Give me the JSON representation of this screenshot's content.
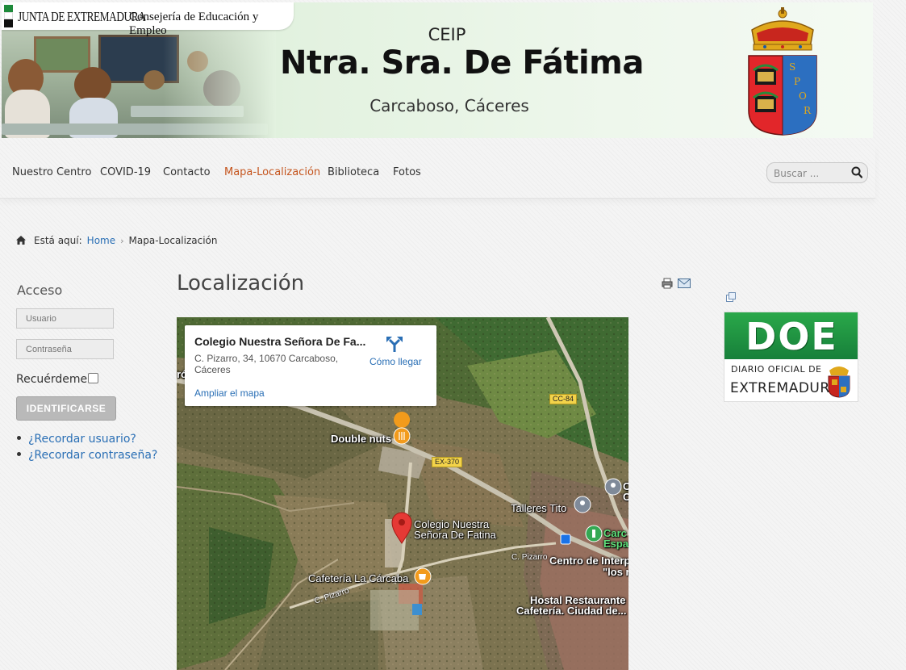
{
  "header": {
    "junta_name": "JUNTA DE EXTREMADURA",
    "junta_department": "Consejería de Educación y Empleo",
    "school_prefix": "CEIP",
    "school_name": "Ntra. Sra. De Fátima",
    "school_location": "Carcaboso, Cáceres",
    "crest_letters": [
      "S",
      "P",
      "O",
      "R"
    ]
  },
  "nav": {
    "items": [
      {
        "label": "Nuestro Centro"
      },
      {
        "label": "COVID-19"
      },
      {
        "label": "Contacto"
      },
      {
        "label": "Mapa-Localización",
        "active": true
      },
      {
        "label": "Biblioteca"
      },
      {
        "label": "Fotos"
      }
    ],
    "search_placeholder": "Buscar ..."
  },
  "breadcrumb": {
    "prefix": "Está aquí:",
    "home": "Home",
    "current": "Mapa-Localización"
  },
  "login": {
    "title": "Acceso",
    "username_placeholder": "Usuario",
    "password_placeholder": "Contraseña",
    "remember_label": "Recuérdeme",
    "remember_checked": false,
    "submit_label": "IDENTIFICARSE",
    "links": [
      "¿Recordar usuario?",
      "¿Recordar contraseña?"
    ]
  },
  "main": {
    "title": "Localización"
  },
  "map": {
    "card": {
      "title": "Colegio Nuestra Señora De Fa...",
      "address_line1": "C. Pizarro, 34, 10670 Carcaboso,",
      "address_line2": "Cáceres",
      "enlarge": "Ampliar el mapa",
      "directions": "Cómo llegar"
    },
    "labels": {
      "double_nuts": "Double nuts",
      "colegio_line1": "Colegio Nuestra",
      "colegio_line2": "Señora De Fatina",
      "talleres": "Talleres Tito",
      "cafeteria": "Cafetería La Cárcaba",
      "centro": "Centro de Interp",
      "los": "\"los r",
      "hostal_line1": "Hostal Restaurante",
      "hostal_line2": "Cafetería. Ciudad de...",
      "carc_line1": "Carc",
      "carc_line2": "Espa",
      "o_edge": "O",
      "c_edge": "C",
      "ro_edge": "ró"
    },
    "roads": {
      "cc84": "CC-84",
      "ex370": "EX-370",
      "pizarro1": "C. Pizarro",
      "pizarro2": "C. Pizarro"
    }
  },
  "sidebar_right": {
    "doe_word": "DOE",
    "doe_line1": "DIARIO OFICIAL DE",
    "doe_line2": "EXTREMADURA"
  },
  "colors": {
    "nav_active": "#c5551e",
    "link": "#2a6fb5",
    "doe_green": "#1f9a45",
    "map_pin": "#d93025",
    "poi_orange": "#f29b1c"
  }
}
